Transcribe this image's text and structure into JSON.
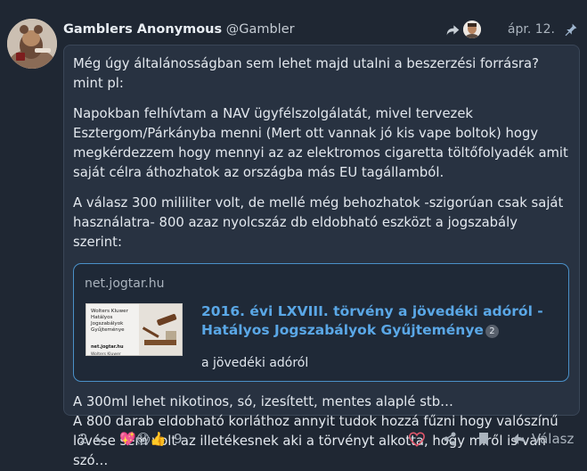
{
  "post": {
    "author": "Gamblers Anonymous",
    "handle": "@Gambler",
    "date": "ápr. 12.",
    "paragraphs": [
      "Még úgy általánosságban sem lehet majd utalni a beszerzési forrásra? mint pl:",
      "Napokban felhívtam a NAV ügyfélszolgálatát, mivel tervezek Esztergom/Párkányba menni (Mert ott vannak jó kis vape boltok) hogy megkérdezzem hogy mennyi az az elektromos cigaretta töltőfolyadék amit saját célra áthozhatok az országba más EU tagállamból.",
      "A válasz 300 mililiter volt, de mellé még behozhatok -szigorúan csak saját használatra- 800 azaz nyolcszáz db eldobható eszközt a jogszabály szerint:"
    ],
    "after_lines": [
      "A 300ml lehet nikotinos, só, izesített, mentes alaplé stb…",
      "A 800 darab eldobható korláthoz annyit tudok hozzá fűzni hogy valószínű lövése sem volt az illetékesnek aki a törvényt alkotta, hogy miről is van szó…"
    ]
  },
  "onebox": {
    "source": "net.jogtar.hu",
    "title": "2016. évi LXVIII. törvény a jövedéki adóról - Hatályos Jogszabályok Gyűjteménye",
    "badge": "2",
    "description": "a jövedéki adóról",
    "thumb_title": "Wolters Kluwer Hatályos Jogszabályok Gyűjteménye",
    "thumb_url": "net.jogtar.hu",
    "thumb_logo": "Wolters Kluwer"
  },
  "actions": {
    "replies_count": "2",
    "reactions_count": "9",
    "reply_label": "Válasz",
    "reaction_emojis": [
      "💖",
      "😱",
      "👍"
    ]
  },
  "colors": {
    "background": "#1f2733",
    "card": "#283241",
    "link": "#5aa7e6",
    "like": "#e0576b"
  },
  "icons": [
    "share-icon",
    "pin-icon",
    "chevron-down-icon",
    "heart-icon",
    "share-link-icon",
    "bookmark-icon",
    "reply-icon"
  ]
}
